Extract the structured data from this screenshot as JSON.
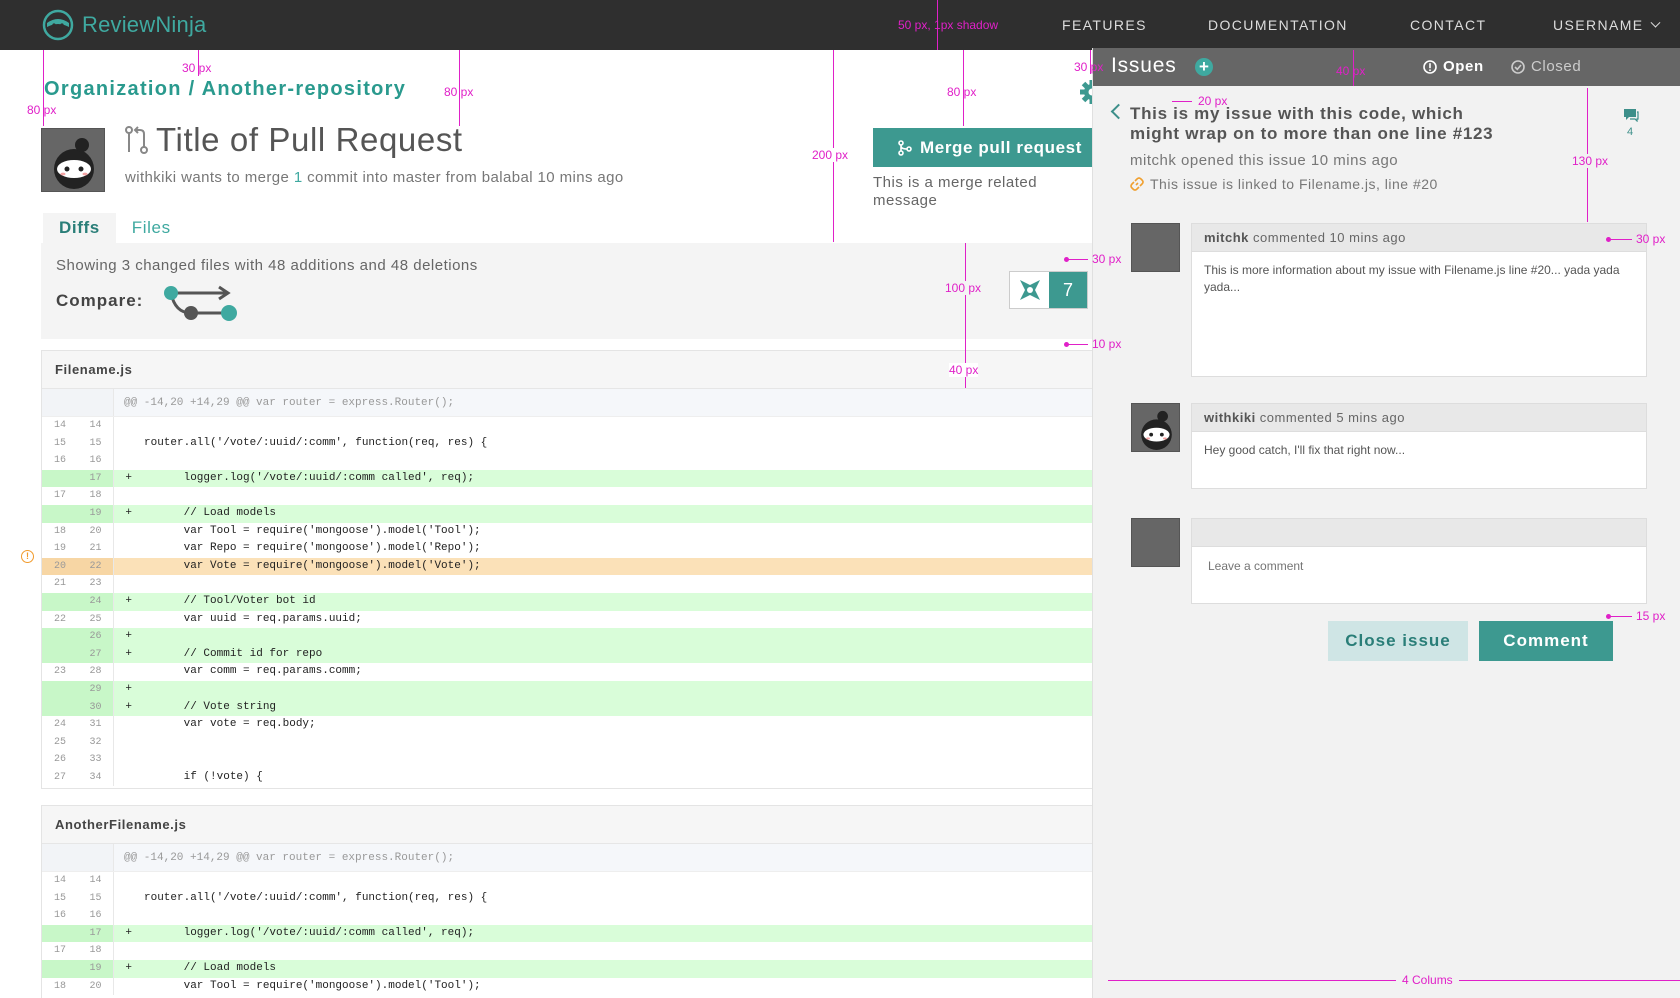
{
  "app": {
    "brand": "ReviewNinja",
    "accent": "#3d9990",
    "topbar_color": "#2f2f2f"
  },
  "nav": {
    "items": [
      "FEATURES",
      "DOCUMENTATION",
      "CONTACT"
    ],
    "username": "USERNAME"
  },
  "pr": {
    "breadcrumb": "Organization / Another-repository",
    "title": "Title of Pull Request",
    "subtitle_prefix": "withkiki wants to merge ",
    "subtitle_count": "1",
    "subtitle_suffix": " commit into master from balabal 10 mins ago",
    "merge_button": "Merge pull request",
    "merge_message": "This is a merge related message"
  },
  "tabs": [
    "Diffs",
    "Files"
  ],
  "summary": {
    "text": "Showing 3 changed files with 48 additions and 48 deletions",
    "compare_label": "Compare:",
    "ninja_count": "7"
  },
  "files": [
    {
      "name": "Filename.js",
      "hunk": "@@ -14,20 +14,29 @@ var router = express.Router();",
      "rows": [
        {
          "o": "14",
          "n": "14",
          "s": "",
          "c": "",
          "t": "ctx"
        },
        {
          "o": "15",
          "n": "15",
          "s": "",
          "c": "router.all('/vote/:uuid/:comm', function(req, res) {",
          "t": "ctx"
        },
        {
          "o": "16",
          "n": "16",
          "s": "",
          "c": "",
          "t": "ctx"
        },
        {
          "o": "",
          "n": "17",
          "s": "+",
          "c": "      logger.log('/vote/:uuid/:comm called', req);",
          "t": "add"
        },
        {
          "o": "17",
          "n": "18",
          "s": "",
          "c": "",
          "t": "ctx"
        },
        {
          "o": "",
          "n": "19",
          "s": "+",
          "c": "      // Load models",
          "t": "add"
        },
        {
          "o": "18",
          "n": "20",
          "s": "",
          "c": "      var Tool = require('mongoose').model('Tool');",
          "t": "ctx"
        },
        {
          "o": "19",
          "n": "21",
          "s": "",
          "c": "      var Repo = require('mongoose').model('Repo');",
          "t": "ctx"
        },
        {
          "o": "20",
          "n": "22",
          "s": "",
          "c": "      var Vote = require('mongoose').model('Vote');",
          "t": "warn"
        },
        {
          "o": "21",
          "n": "23",
          "s": "",
          "c": "",
          "t": "ctx"
        },
        {
          "o": "",
          "n": "24",
          "s": "+",
          "c": "      // Tool/Voter bot id",
          "t": "add"
        },
        {
          "o": "22",
          "n": "25",
          "s": "",
          "c": "      var uuid = req.params.uuid;",
          "t": "ctx"
        },
        {
          "o": "",
          "n": "26",
          "s": "+",
          "c": "",
          "t": "add"
        },
        {
          "o": "",
          "n": "27",
          "s": "+",
          "c": "      // Commit id for repo",
          "t": "add"
        },
        {
          "o": "23",
          "n": "28",
          "s": "",
          "c": "      var comm = req.params.comm;",
          "t": "ctx"
        },
        {
          "o": "",
          "n": "29",
          "s": "+",
          "c": "",
          "t": "add"
        },
        {
          "o": "",
          "n": "30",
          "s": "+",
          "c": "      // Vote string",
          "t": "add"
        },
        {
          "o": "24",
          "n": "31",
          "s": "",
          "c": "      var vote = req.body;",
          "t": "ctx"
        },
        {
          "o": "25",
          "n": "32",
          "s": "",
          "c": "",
          "t": "ctx"
        },
        {
          "o": "26",
          "n": "33",
          "s": "",
          "c": "",
          "t": "ctx"
        },
        {
          "o": "27",
          "n": "34",
          "s": "",
          "c": "      if (!vote) {",
          "t": "ctx"
        }
      ]
    },
    {
      "name": "AnotherFilename.js",
      "hunk": "@@ -14,20 +14,29 @@ var router = express.Router();",
      "rows": [
        {
          "o": "14",
          "n": "14",
          "s": "",
          "c": "",
          "t": "ctx"
        },
        {
          "o": "15",
          "n": "15",
          "s": "",
          "c": "router.all('/vote/:uuid/:comm', function(req, res) {",
          "t": "ctx"
        },
        {
          "o": "16",
          "n": "16",
          "s": "",
          "c": "",
          "t": "ctx"
        },
        {
          "o": "",
          "n": "17",
          "s": "+",
          "c": "      logger.log('/vote/:uuid/:comm called', req);",
          "t": "add"
        },
        {
          "o": "17",
          "n": "18",
          "s": "",
          "c": "",
          "t": "ctx"
        },
        {
          "o": "",
          "n": "19",
          "s": "+",
          "c": "      // Load models",
          "t": "add"
        },
        {
          "o": "18",
          "n": "20",
          "s": "",
          "c": "      var Tool = require('mongoose').model('Tool');",
          "t": "ctx"
        }
      ]
    }
  ],
  "issues": {
    "title": "Issues",
    "open_label": "Open",
    "closed_label": "Closed",
    "issue_title": "This is my issue with this code, which might wrap on to more than one line #123",
    "issue_meta": "mitchk opened this issue 10 mins ago",
    "issue_link": "This issue is linked to Filename.js, line #20",
    "comment_count": "4",
    "comments": [
      {
        "author": "mitchk",
        "when": " commented 10 mins ago",
        "body": "This is more information about my issue with Filename.js line #20... yada yada yada..."
      },
      {
        "author": "withkiki",
        "when": " commented 5 mins ago",
        "body": "Hey good catch, I'll fix that right now..."
      }
    ],
    "comment_placeholder": "Leave a comment",
    "close_button": "Close issue",
    "comment_button": "Comment"
  },
  "annotations": {
    "topbar": "50 px, 1px shadow",
    "px80": "80 px",
    "px30": "30 px",
    "px200": "200 px",
    "px100": "100 px",
    "px40": "40 px",
    "px10": "10 px",
    "px20": "20 px",
    "px130": "130 px",
    "px15": "15 px",
    "columns": "4 Colums"
  }
}
